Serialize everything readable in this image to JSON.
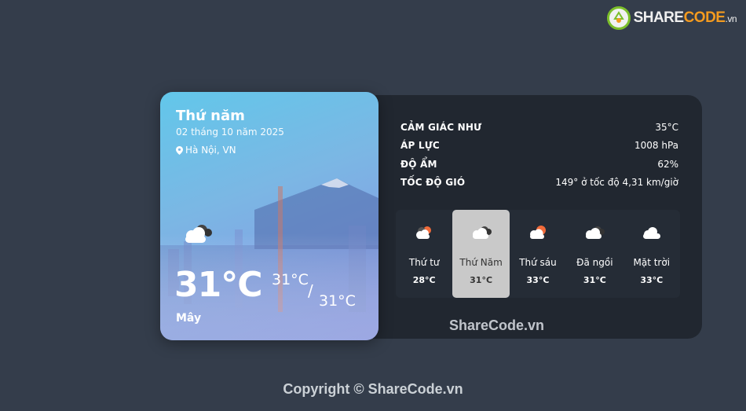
{
  "watermark": {
    "brand_main": "SHARE",
    "brand_accent": "CODE",
    "brand_suffix": ".vn"
  },
  "card": {
    "day_name": "Thứ năm",
    "date": "02 tháng 10 năm 2025",
    "location": "Hà Nội, VN",
    "temperature": "31°C",
    "temp_high": "31°C",
    "temp_separator": "/",
    "temp_low": "31°C",
    "condition": "Mây",
    "icon": "cloud-icon"
  },
  "stats": [
    {
      "label": "CẢM GIÁC NHƯ",
      "value": "35°C"
    },
    {
      "label": "ÁP LỰC",
      "value": "1008 hPa"
    },
    {
      "label": "ĐỘ ẨM",
      "value": "62%"
    },
    {
      "label": "TỐC ĐỘ GIÓ",
      "value": "149° ở tốc độ 4,31 km/giờ"
    }
  ],
  "forecast": [
    {
      "day": "Thứ tư",
      "temp": "28°C",
      "icon": "sun-cloud-icon",
      "active": false
    },
    {
      "day": "Thứ Năm",
      "temp": "31°C",
      "icon": "cloud-icon",
      "active": true
    },
    {
      "day": "Thứ sáu",
      "temp": "33°C",
      "icon": "sun-cloud-icon",
      "active": false
    },
    {
      "day": "Đã ngồi",
      "temp": "31°C",
      "icon": "cloud-icon",
      "active": false
    },
    {
      "day": "Mặt trời",
      "temp": "33°C",
      "icon": "cloud-icon",
      "active": false
    }
  ],
  "mid_watermark": "ShareCode.vn",
  "footer": "Copyright © ShareCode.vn",
  "colors": {
    "background": "#343d4b",
    "panel": "#212730",
    "active_day": "#c9c9c9",
    "sun": "#f26b3a"
  }
}
